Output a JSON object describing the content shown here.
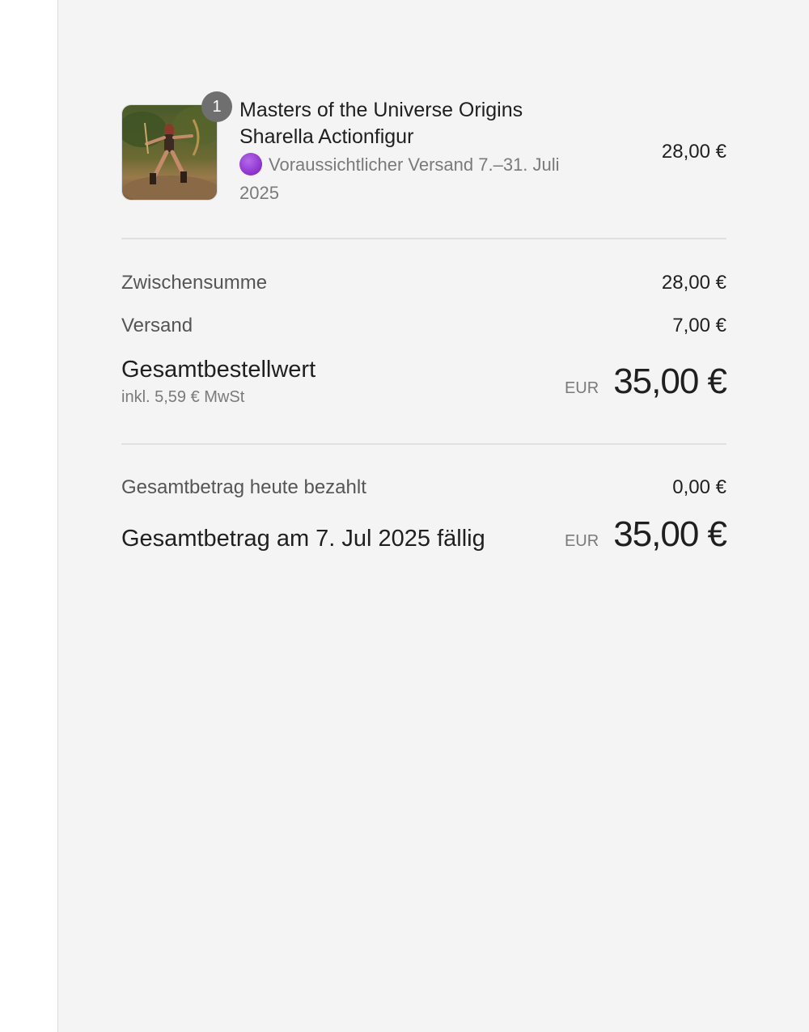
{
  "order": {
    "item": {
      "quantity": "1",
      "name_line1": "Masters of the Universe Origins",
      "name_line2": "Sharella Actionfigur",
      "shipping_line1": "Voraussichtlicher Versand 7.–31. Juli",
      "shipping_line2": "2025",
      "price": "28,00 €",
      "status_dot_color": "#8a2fd1"
    },
    "summary": {
      "subtotal_label": "Zwischensumme",
      "subtotal_value": "28,00 €",
      "shipping_label": "Versand",
      "shipping_value": "7,00 €",
      "total_label": "Gesamtbestellwert",
      "tax_note": "inkl. 5,59 € MwSt",
      "total_currency": "EUR",
      "total_value": "35,00 €"
    },
    "payment": {
      "paid_today_label": "Gesamtbetrag heute bezahlt",
      "paid_today_value": "0,00 €",
      "due_label": "Gesamtbetrag am 7. Jul 2025 fällig",
      "due_currency": "EUR",
      "due_value": "35,00 €"
    }
  }
}
